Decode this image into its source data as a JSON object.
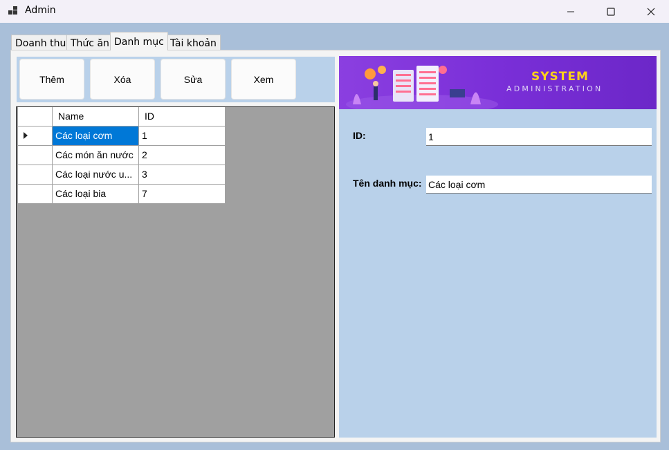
{
  "window": {
    "title": "Admin",
    "minimize_icon": "minimize-icon",
    "maximize_icon": "maximize-icon",
    "close_icon": "close-icon"
  },
  "tabs": [
    {
      "label": "Doanh thu",
      "active": false
    },
    {
      "label": "Thức ăn",
      "active": false
    },
    {
      "label": "Danh mục",
      "active": true
    },
    {
      "label": "Tài khoản",
      "active": false
    }
  ],
  "toolbar": {
    "add_label": "Thêm",
    "delete_label": "Xóa",
    "edit_label": "Sửa",
    "view_label": "Xem"
  },
  "grid": {
    "columns": [
      "Name",
      "ID"
    ],
    "rows": [
      {
        "name": "Các loại cơm",
        "id": "1"
      },
      {
        "name": "Các món ăn nước",
        "id": "2"
      },
      {
        "name": "Các loại nước u...",
        "id": "3"
      },
      {
        "name": "Các loại bia",
        "id": "7"
      }
    ],
    "selected_row": 0
  },
  "banner": {
    "line1": "SYSTEM",
    "line2": "ADMINISTRATION"
  },
  "form": {
    "id_label": "ID:",
    "id_value": "1",
    "name_label": "Tên danh mục:",
    "name_value": "Các loại cơm"
  },
  "colors": {
    "accent_selection": "#0078d7",
    "panel_bg": "#b9d1ea",
    "banner_purple": "#7a2fd8",
    "banner_yellow": "#ffd21a"
  }
}
